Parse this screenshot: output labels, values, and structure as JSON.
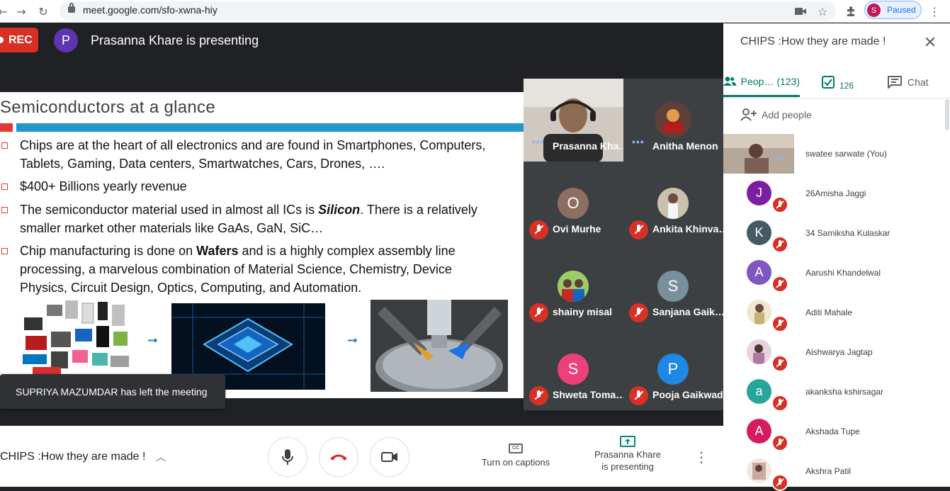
{
  "browser": {
    "url": "meet.google.com/sfo-xwna-hiy",
    "profile_initial": "S",
    "profile_status": "Paused"
  },
  "stage": {
    "rec_label": "REC",
    "presenter_initial": "P",
    "presenting_text": "Prasanna Khare is presenting"
  },
  "slide": {
    "title": "Semiconductors at a glance",
    "bullets": [
      {
        "text_a": "Chips are at the heart of all electronics and are found in Smartphones, Computers, Tablets, Gaming, Data centers, Smartwatches, Cars, Drones, …."
      },
      {
        "text_a": "$400+ Billions yearly revenue"
      },
      {
        "text_a": "The semiconductor material used in almost all ICs is ",
        "bold": "Silicon",
        "text_b": ". There is a relatively smaller market other materials like GaAs, GaN, SiC…"
      },
      {
        "text_a": "Chip manufacturing is done on ",
        "bold": "Wafers",
        "text_b": " and is a highly complex assembly line processing, a marvelous combination of Material Science, Chemistry, Device Physics, Circuit Design, Optics, Computing, and Automation."
      }
    ],
    "arrow_glyph": "➞"
  },
  "toast": {
    "text": "SUPRIYA MAZUMDAR has left the meeting"
  },
  "tiles": [
    {
      "name": "Prasanna Kha…",
      "type": "video",
      "initial": ""
    },
    {
      "name": "Anitha Menon",
      "type": "photo",
      "initial": ""
    },
    {
      "name": "Ovi Murhe",
      "type": "initial",
      "initial": "O",
      "color": "#8d6e63"
    },
    {
      "name": "Ankita Khinva…",
      "type": "photo",
      "initial": ""
    },
    {
      "name": "shainy misal",
      "type": "photo",
      "initial": ""
    },
    {
      "name": "Sanjana Gaik…",
      "type": "initial",
      "initial": "S",
      "color": "#78909c"
    },
    {
      "name": "Shweta Toma…",
      "type": "initial",
      "initial": "S",
      "color": "#ec407a"
    },
    {
      "name": "Pooja Gaikwad",
      "type": "initial",
      "initial": "P",
      "color": "#1e88e5"
    }
  ],
  "bottombar": {
    "meeting_title": "CHIPS :How they are made !",
    "captions_label": "Turn on captions",
    "captions_icon_text": "CC",
    "presenting_line1": "Prasanna Khare",
    "presenting_line2": "is presenting"
  },
  "panel": {
    "title": "CHIPS :How they are made !",
    "tab_people": "Peop…",
    "tab_people_count": "(123)",
    "tab_tasks_count": "126",
    "tab_chat": "Chat",
    "add_people": "Add people",
    "participants": [
      {
        "name": "swatee sarwate (You)",
        "initial": "",
        "color": "#6d4c41",
        "photo": true,
        "self": true
      },
      {
        "name": "26Amisha Jaggi",
        "initial": "J",
        "color": "#7b1fa2"
      },
      {
        "name": "34 Samiksha Kulaskar",
        "initial": "K",
        "color": "#455a64"
      },
      {
        "name": "Aarushi Khandelwal",
        "initial": "A",
        "color": "#7e57c2"
      },
      {
        "name": "Aditi Mahale",
        "initial": "",
        "color": "#c5b27a",
        "photo": true
      },
      {
        "name": "Aishwarya Jagtap",
        "initial": "",
        "color": "#b07aa0",
        "photo": true
      },
      {
        "name": "akanksha kshirsagar",
        "initial": "a",
        "color": "#26a69a"
      },
      {
        "name": "Akshada Tupe",
        "initial": "A",
        "color": "#d81b60"
      },
      {
        "name": "Akshra Patil",
        "initial": "",
        "color": "#c9a9a0",
        "photo": true
      }
    ]
  },
  "colors": {
    "accent": "#00796b",
    "danger": "#d93025",
    "slide_blue": "#2196c9",
    "slide_red": "#e53935"
  }
}
